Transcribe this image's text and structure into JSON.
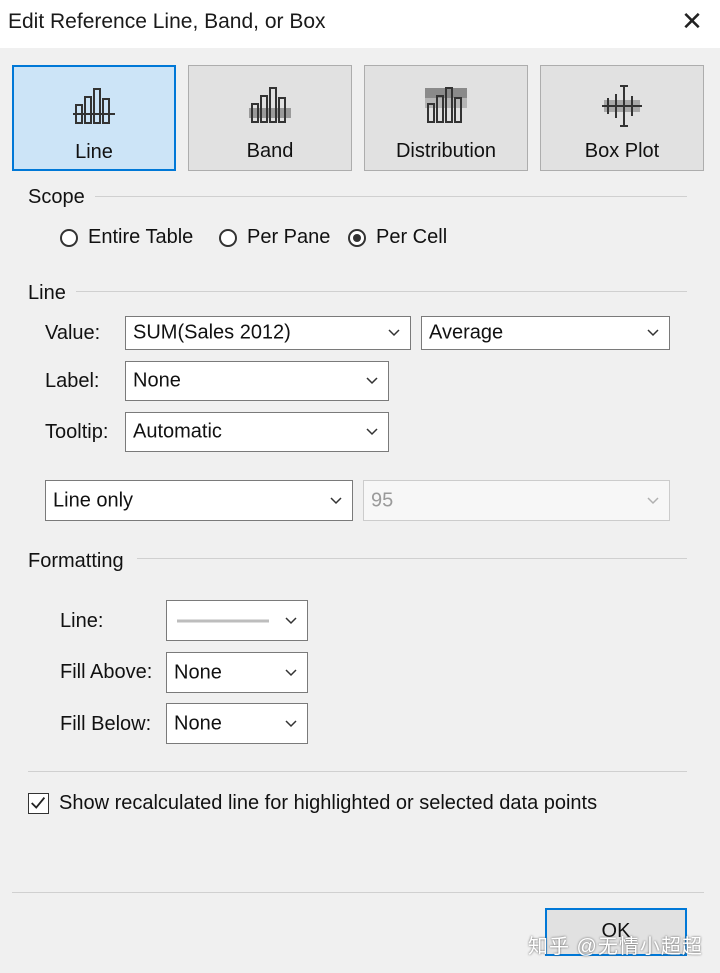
{
  "window": {
    "title": "Edit Reference Line, Band, or Box",
    "close_glyph": "✕"
  },
  "type_buttons": [
    {
      "label": "Line",
      "icon": "line-icon",
      "selected": true
    },
    {
      "label": "Band",
      "icon": "band-icon",
      "selected": false
    },
    {
      "label": "Distribution",
      "icon": "distribution-icon",
      "selected": false
    },
    {
      "label": "Box Plot",
      "icon": "box-plot-icon",
      "selected": false
    }
  ],
  "scope": {
    "label": "Scope",
    "options": [
      {
        "label": "Entire Table",
        "checked": false
      },
      {
        "label": "Per Pane",
        "checked": false
      },
      {
        "label": "Per Cell",
        "checked": true
      }
    ]
  },
  "line": {
    "label": "Line",
    "value_label": "Value:",
    "value_field": "SUM(Sales 2012)",
    "value_agg": "Average",
    "label_label": "Label:",
    "label_value": "None",
    "tooltip_label": "Tooltip:",
    "tooltip_value": "Automatic",
    "line_mode": "Line only",
    "confidence": "95"
  },
  "formatting": {
    "label": "Formatting",
    "line_label": "Line:",
    "fill_above_label": "Fill Above:",
    "fill_above_value": "None",
    "fill_below_label": "Fill Below:",
    "fill_below_value": "None",
    "line_color": "#bdbdbd"
  },
  "recalc": {
    "label": "Show recalculated line for highlighted or selected data points",
    "checked": true
  },
  "ok_label": "OK",
  "watermark": "知乎 @无情小超超",
  "colors": {
    "accent": "#0078d7",
    "selected_bg": "#cce4f7",
    "dialog_bg": "#f0f0f0"
  }
}
